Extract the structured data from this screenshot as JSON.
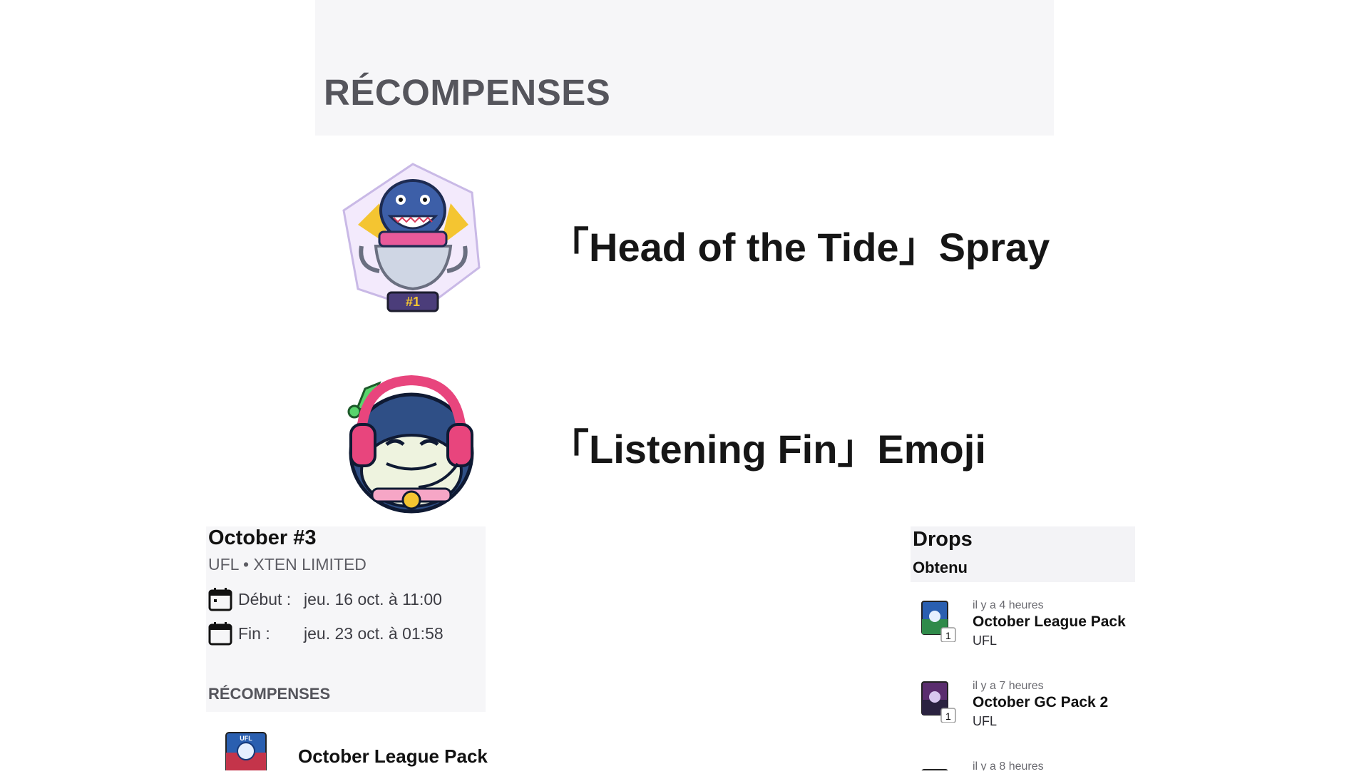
{
  "header": {
    "title": "RÉCOMPENSES"
  },
  "rewards": [
    {
      "name": "「Head of the Tide」Spray",
      "icon": "shark-trophy-spray-icon"
    },
    {
      "name": "「Listening Fin」Emoji",
      "icon": "shark-headphones-emoji-icon"
    }
  ],
  "event": {
    "title": "October #3",
    "subtitle": "UFL • XTEN LIMITED",
    "start_label": "Début :",
    "start_value": "jeu. 16 oct. à 11:00",
    "end_label": "Fin :",
    "end_value": "jeu. 23 oct. à 01:58",
    "rewards_heading": "RÉCOMPENSES",
    "reward_item": "October League Pack"
  },
  "drops": {
    "title": "Drops",
    "subtitle": "Obtenu",
    "items": [
      {
        "time": "il y a 4 heures",
        "name": "October League Pack",
        "source": "UFL",
        "count": "1",
        "color": "#2a5fb0"
      },
      {
        "time": "il y a 7 heures",
        "name": "October GC Pack 2",
        "source": "UFL",
        "count": "1",
        "color": "#5a2d6e"
      },
      {
        "time": "il y a 8 heures",
        "name": "",
        "source": "",
        "count": "",
        "color": "#b06a2a"
      }
    ]
  },
  "colors": {
    "panel": "#f6f6f8",
    "heading": "#55555c",
    "text": "#141414"
  }
}
